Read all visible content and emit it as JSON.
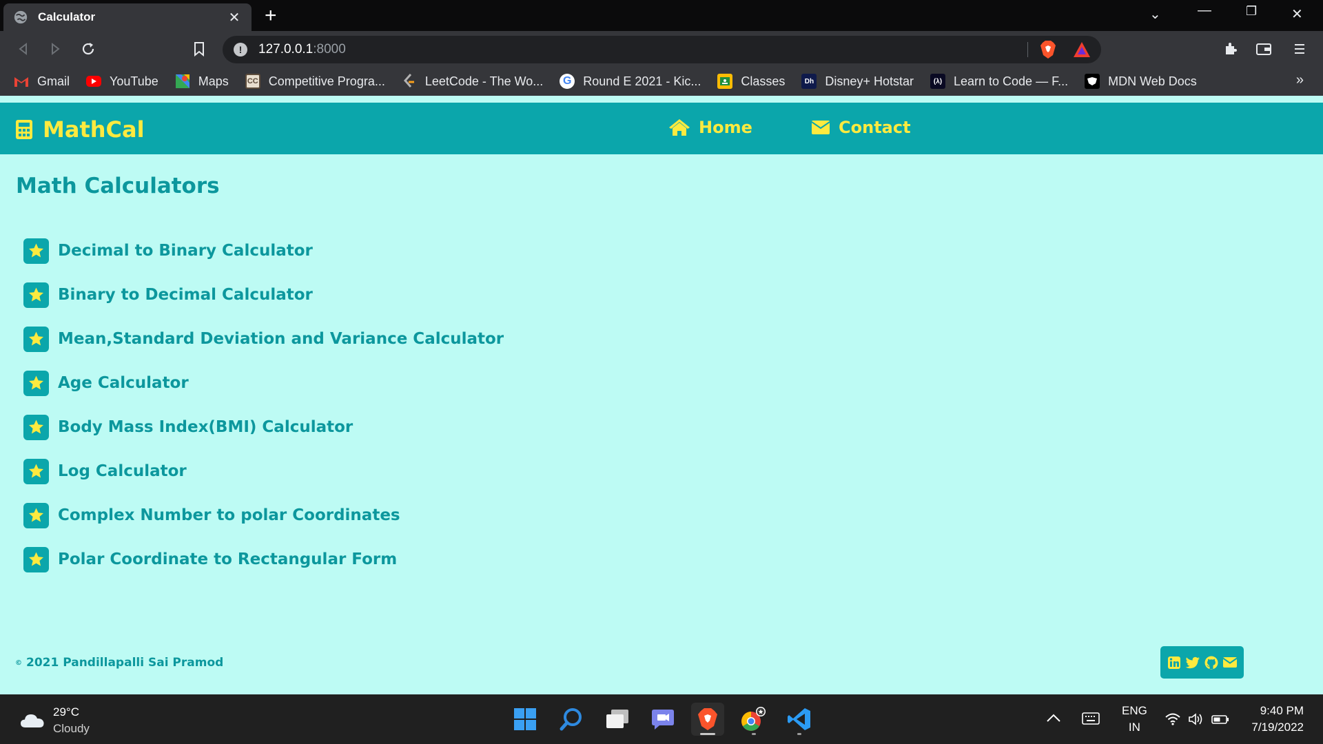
{
  "browser": {
    "tab_title": "Calculator",
    "url_host": "127.0.0.1",
    "url_port": ":8000",
    "bookmarks": [
      {
        "label": "Gmail",
        "icon": "gmail-icon",
        "color": "#ea4335"
      },
      {
        "label": "YouTube",
        "icon": "youtube-icon",
        "color": "#ff0000"
      },
      {
        "label": "Maps",
        "icon": "maps-icon",
        "color": "#34a853"
      },
      {
        "label": "Competitive Progra...",
        "icon": "cc-icon",
        "color": "#5c4b3a"
      },
      {
        "label": "LeetCode - The Wo...",
        "icon": "leetcode-icon",
        "color": "#f89f1b"
      },
      {
        "label": "Round E 2021 - Kic...",
        "icon": "google-icon",
        "color": "#4285f4"
      },
      {
        "label": "Classes",
        "icon": "classroom-icon",
        "color": "#fbbc04"
      },
      {
        "label": "Disney+ Hotstar",
        "icon": "hotstar-icon",
        "color": "#0f1a4b"
      },
      {
        "label": "Learn to Code — F...",
        "icon": "freecodecamp-icon",
        "color": "#0a0a23"
      },
      {
        "label": "MDN Web Docs",
        "icon": "mdn-icon",
        "color": "#000000"
      }
    ],
    "more_glyph": "»"
  },
  "site": {
    "brand": "MathCal",
    "nav": {
      "home": "Home",
      "contact": "Contact"
    },
    "title": "Math Calculators",
    "calculators": [
      "Decimal to Binary Calculator",
      "Binary to Decimal Calculator",
      "Mean,Standard Deviation and Variance Calculator",
      "Age Calculator",
      "Body Mass Index(BMI) Calculator",
      "Log Calculator",
      "Complex Number to polar Coordinates",
      "Polar Coordinate to Rectangular Form"
    ],
    "copyright_symbol": "©",
    "copyright": "2021 Pandillapalli Sai Pramod",
    "colors": {
      "accent": "#0ba6ab",
      "highlight": "#fdea3f",
      "background": "#bdfbf4",
      "text": "#0c979d"
    }
  },
  "taskbar": {
    "weather_temp": "29°C",
    "weather_desc": "Cloudy",
    "lang_top": "ENG",
    "lang_bottom": "IN",
    "time": "9:40 PM",
    "date": "7/19/2022"
  }
}
